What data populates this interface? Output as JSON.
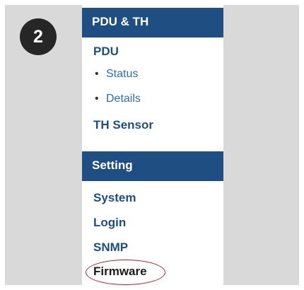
{
  "step_badge": "2",
  "nav": {
    "sections": [
      {
        "header": "PDU & TH",
        "items": [
          "PDU",
          "TH Sensor"
        ],
        "sub_items": [
          "Status",
          "Details"
        ]
      },
      {
        "header": "Setting",
        "items": [
          "System",
          "Login",
          "SNMP",
          "Firmware"
        ]
      }
    ],
    "bullet": "•",
    "highlighted_item": "Firmware"
  },
  "colors": {
    "header_bg": "#1f4e82",
    "link": "#1f4e82",
    "sub_link": "#2e6db4",
    "highlight": "#b01e2a",
    "frame_bg": "#d9d9d9",
    "badge_bg": "#262626"
  }
}
